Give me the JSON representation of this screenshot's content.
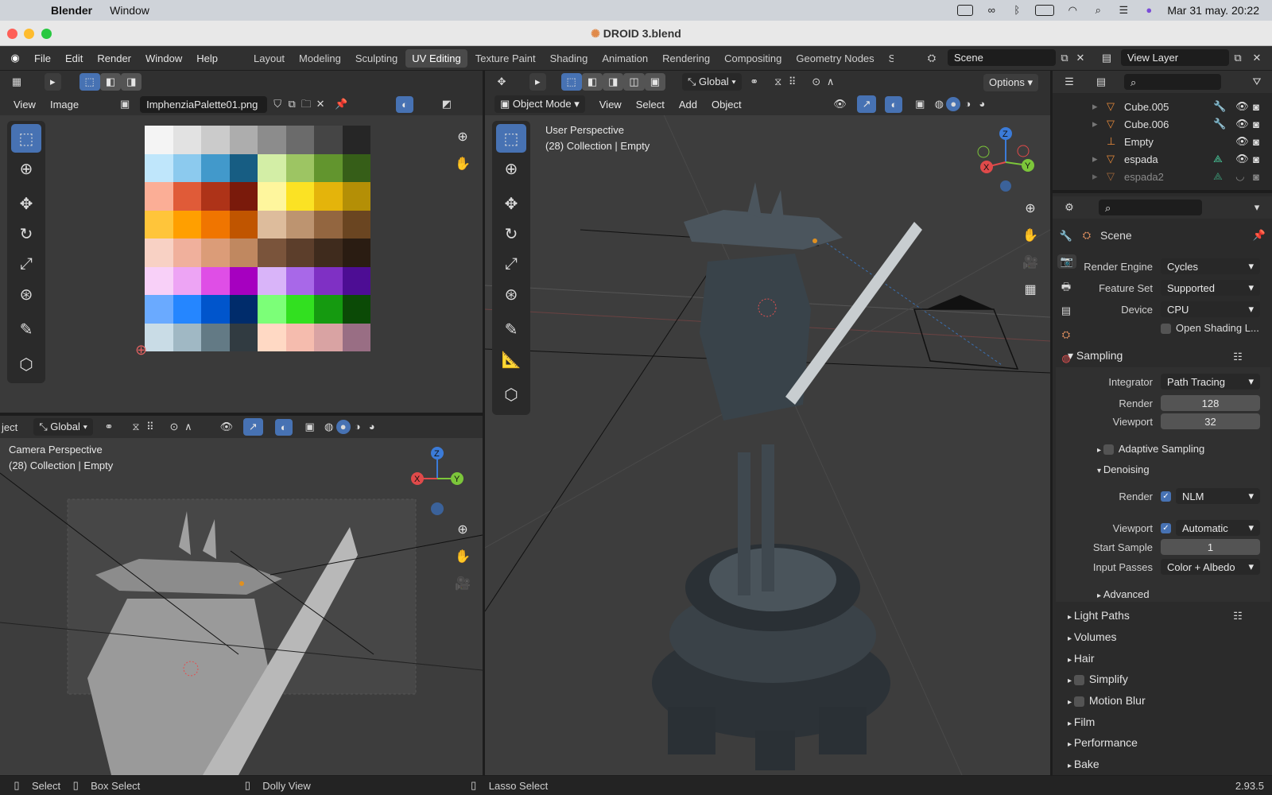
{
  "menubar": {
    "app": "Blender",
    "items": [
      "Window"
    ],
    "datetime": "Mar 31 may.  20:22"
  },
  "window": {
    "title": "DROID 3.blend"
  },
  "topbar": {
    "menus": [
      "File",
      "Edit",
      "Render",
      "Window",
      "Help"
    ],
    "workspaces": [
      "Layout",
      "Modeling",
      "Sculpting",
      "UV Editing",
      "Texture Paint",
      "Shading",
      "Animation",
      "Rendering",
      "Compositing",
      "Geometry Nodes",
      "S"
    ],
    "active_workspace": "UV Editing",
    "scene": "Scene",
    "view_layer": "View Layer"
  },
  "uv_editor": {
    "menus": [
      "View",
      "Image"
    ],
    "image_name": "ImphenziaPalette01.png",
    "palette": [
      [
        "#f4f4f4",
        "#e2e2e2",
        "#cbcbcb",
        "#adadad",
        "#8c8c8c",
        "#6b6b6b",
        "#454545",
        "#262626"
      ],
      [
        "#bfe6fb",
        "#8ccaee",
        "#4299cb",
        "#175d83",
        "#d3eea6",
        "#9dc563",
        "#62952e",
        "#365e18"
      ],
      [
        "#fbae96",
        "#e05b38",
        "#ae3318",
        "#7a1a0b",
        "#fef69d",
        "#fbe224",
        "#e4b40b",
        "#b48f06"
      ],
      [
        "#ffc53a",
        "#ff9f00",
        "#f07500",
        "#c05500",
        "#ddbc9c",
        "#bd9470",
        "#936640",
        "#6a4521"
      ],
      [
        "#f8d1c4",
        "#f0b09c",
        "#db9c78",
        "#c08860",
        "#7a543b",
        "#5c3e2b",
        "#3f2b1d",
        "#2a1c12"
      ],
      [
        "#f8d0f8",
        "#eda4f4",
        "#df4ee6",
        "#a600c0",
        "#d9b4f9",
        "#a868e8",
        "#7f30c4",
        "#4d0d94"
      ],
      [
        "#6aaaff",
        "#2586ff",
        "#0055cc",
        "#002c6b",
        "#7cff78",
        "#32e020",
        "#159a10",
        "#0b4a06"
      ],
      [
        "#c9dce6",
        "#a0b8c4",
        "#637a85",
        "#313b41",
        "#ffd9c4",
        "#f5bcae",
        "#d9a3a3",
        "#996e84"
      ]
    ]
  },
  "viewport_top": {
    "orientation": "Global",
    "mode": "Object Mode",
    "menus": [
      "View",
      "Select",
      "Add",
      "Object"
    ],
    "options": "Options",
    "perspective": "User Perspective",
    "collection": "(28) Collection | Empty"
  },
  "viewport_bottom": {
    "mode_partial": "ject",
    "orientation": "Global",
    "perspective": "Camera Perspective",
    "collection": "(28) Collection | Empty"
  },
  "outliner": {
    "items": [
      {
        "name": "Cube.005",
        "type": "mesh"
      },
      {
        "name": "Cube.006",
        "type": "mesh"
      },
      {
        "name": "Empty",
        "type": "empty"
      },
      {
        "name": "espada",
        "type": "mesh"
      },
      {
        "name": "espada2",
        "type": "mesh"
      }
    ]
  },
  "properties": {
    "context": "Scene",
    "render_engine": {
      "label": "Render Engine",
      "value": "Cycles"
    },
    "feature_set": {
      "label": "Feature Set",
      "value": "Supported"
    },
    "device": {
      "label": "Device",
      "value": "CPU"
    },
    "open_shading": "Open Shading L...",
    "sampling": {
      "title": "Sampling",
      "integrator": {
        "label": "Integrator",
        "value": "Path Tracing"
      },
      "render": {
        "label": "Render",
        "value": "128"
      },
      "viewport": {
        "label": "Viewport",
        "value": "32"
      },
      "adaptive": "Adaptive Sampling",
      "denoising": {
        "title": "Denoising",
        "render": {
          "label": "Render",
          "value": "NLM"
        },
        "viewport": {
          "label": "Viewport",
          "value": "Automatic"
        },
        "start_sample": {
          "label": "Start Sample",
          "value": "1"
        },
        "input_passes": {
          "label": "Input Passes",
          "value": "Color + Albedo"
        }
      },
      "advanced": "Advanced"
    },
    "sections": [
      "Light Paths",
      "Volumes",
      "Hair",
      "Simplify",
      "Motion Blur",
      "Film",
      "Performance",
      "Bake"
    ]
  },
  "statusbar": {
    "select": "Select",
    "box_select": "Box Select",
    "dolly_view": "Dolly View",
    "lasso_select": "Lasso Select",
    "version": "2.93.5"
  },
  "colors": {
    "accent": "#4772b3",
    "panel": "#303030",
    "viewport": "#3d3d3d"
  }
}
